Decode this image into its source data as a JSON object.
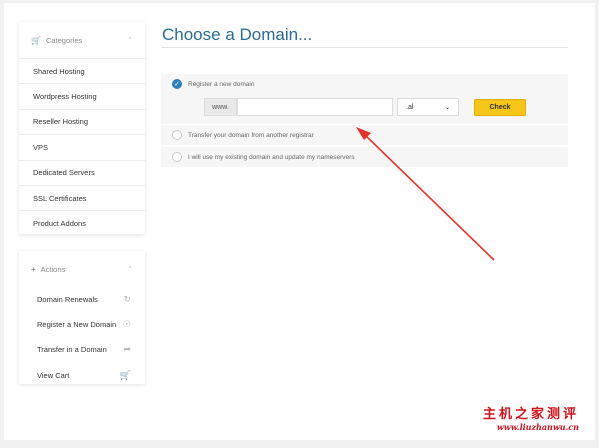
{
  "sidebar": {
    "categories": {
      "title": "Categories",
      "icon": "cart-icon",
      "items": [
        {
          "label": "Shared Hosting"
        },
        {
          "label": "Wordpress Hosting"
        },
        {
          "label": "Reseller Hosting"
        },
        {
          "label": "VPS"
        },
        {
          "label": "Dedicated Servers"
        },
        {
          "label": "SSL Certificates"
        },
        {
          "label": "Product Addons"
        }
      ]
    },
    "actions": {
      "title": "Actions",
      "icon": "plus-icon",
      "items": [
        {
          "label": "Domain Renewals",
          "icon": "refresh-icon"
        },
        {
          "label": "Register a New Domain",
          "icon": "globe-icon"
        },
        {
          "label": "Transfer in a Domain",
          "icon": "share-icon"
        },
        {
          "label": "View Cart",
          "icon": "cart-icon"
        }
      ]
    }
  },
  "main": {
    "title": "Choose a Domain...",
    "options": {
      "register": {
        "label": "Register a new domain",
        "selected": true
      },
      "transfer": {
        "label": "Transfer your domain from another registrar",
        "selected": false
      },
      "existing": {
        "label": "I will use my existing domain and update my nameservers",
        "selected": false
      }
    },
    "domain_form": {
      "prefix": "www.",
      "input_value": "",
      "tld": ".al",
      "check_label": "Check"
    }
  },
  "watermark": {
    "text": "主机之家测评",
    "url": "www.liuzhanwu.cn"
  },
  "colors": {
    "title": "#2a6b93",
    "check_button": "#f5c518",
    "radio_selected": "#2d7fb8",
    "arrow": "#e8312b",
    "watermark": "#d0121b"
  }
}
